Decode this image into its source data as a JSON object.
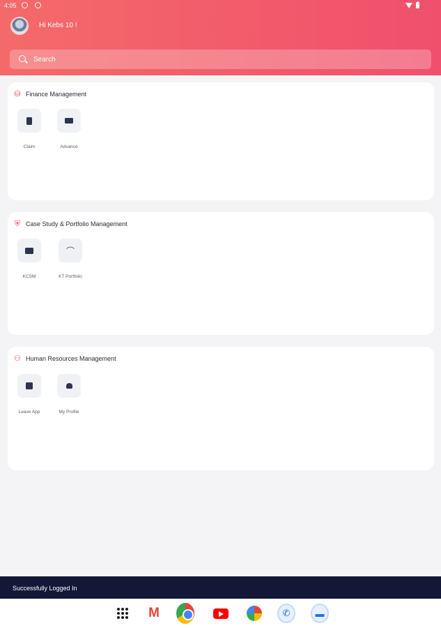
{
  "status_bar": {
    "time": "4:05"
  },
  "header": {
    "greeting": "Hi Kebs 10 !"
  },
  "search": {
    "placeholder": "Search"
  },
  "sections": [
    {
      "title": "Finance Management",
      "icon": "finance-icon",
      "tiles": [
        {
          "label": "Claim",
          "icon": "claim-icon"
        },
        {
          "label": "Advance",
          "icon": "advance-icon"
        }
      ]
    },
    {
      "title": "Case Study & Portfolio Management",
      "icon": "portfolio-shield-icon",
      "tiles": [
        {
          "label": "KCSM",
          "icon": "folder-icon"
        },
        {
          "label": "KT Portfolio",
          "icon": "hanger-icon"
        }
      ]
    },
    {
      "title": "Human Resources Management",
      "icon": "people-icon",
      "tiles": [
        {
          "label": "Leave App",
          "icon": "calendar-icon"
        },
        {
          "label": "My Profile",
          "icon": "person-icon"
        }
      ]
    }
  ],
  "toast": {
    "message": "Successfully Logged In"
  },
  "dock": [
    "apps-icon",
    "gmail-icon",
    "chrome-icon",
    "youtube-icon",
    "photos-icon",
    "phone-icon",
    "messages-icon"
  ],
  "colors": {
    "header_start": "#f46a6a",
    "header_end": "#f0506c",
    "accent": "#ec4a5f",
    "toast_bg": "#121836"
  }
}
